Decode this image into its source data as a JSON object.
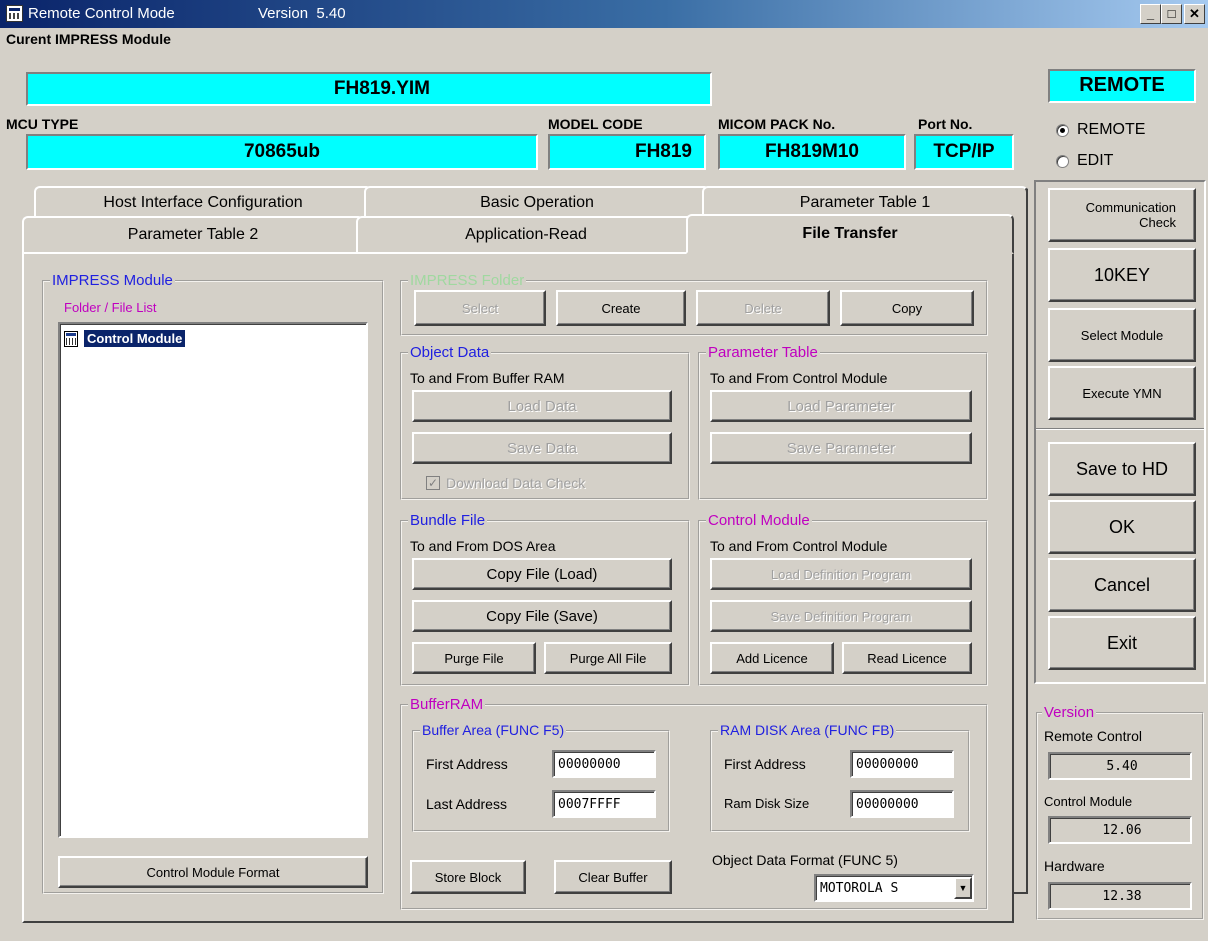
{
  "window": {
    "title": "Remote Control Mode",
    "version": "Version  5.40",
    "min_glyph": "_",
    "max_glyph": "□",
    "close_glyph": "✕"
  },
  "header": {
    "module_label": "Curent IMPRESS Module",
    "module_value": "FH819.YIM",
    "mcu_label": "MCU TYPE",
    "mcu_value": "70865ub",
    "model_label": "MODEL CODE",
    "model_value": "FH819",
    "micom_label": "MICOM PACK No.",
    "micom_value": "FH819M10",
    "port_label": "Port No.",
    "port_value": "TCP/IP"
  },
  "mode": {
    "status": "REMOTE",
    "options": [
      "REMOTE",
      "EDIT"
    ],
    "selected": "REMOTE"
  },
  "tabs": {
    "row1": [
      "Host Interface Configuration",
      "Basic Operation",
      "Parameter Table 1"
    ],
    "row2": [
      "Parameter Table 2",
      "Application-Read",
      "File Transfer"
    ],
    "active": "File Transfer"
  },
  "impress_module": {
    "title": "IMPRESS Module",
    "list_label": "Folder / File  List",
    "items": [
      "Control Module"
    ],
    "format_button": "Control Module Format"
  },
  "impress_folder": {
    "title": "IMPRESS Folder",
    "buttons": [
      "Select",
      "Create",
      "Delete",
      "Copy"
    ]
  },
  "object_data": {
    "title": "Object Data",
    "subtitle": "To and From Buffer RAM",
    "load": "Load Data",
    "save": "Save Data",
    "check_label": "Download Data Check",
    "check_glyph": "✓"
  },
  "parameter_table": {
    "title": "Parameter Table",
    "subtitle": "To and From Control Module",
    "load": "Load Parameter",
    "save": "Save Parameter"
  },
  "bundle_file": {
    "title": "Bundle File",
    "subtitle": "To and From DOS Area",
    "copy_load": "Copy File (Load)",
    "copy_save": "Copy File (Save)",
    "purge": "Purge File",
    "purge_all": "Purge All File"
  },
  "control_module": {
    "title": "Control Module",
    "subtitle": "To and From Control Module",
    "load_def": "Load Definition Program",
    "save_def": "Save Definition Program",
    "add_licence": "Add Licence",
    "read_licence": "Read Licence"
  },
  "buffer_ram": {
    "title": "BufferRAM",
    "buffer_area": {
      "title": "Buffer Area (FUNC F5)",
      "first_label": "First  Address",
      "first_value": "00000000",
      "last_label": "Last  Address",
      "last_value": "0007FFFF"
    },
    "ram_disk": {
      "title": "RAM DISK Area (FUNC FB)",
      "first_label": "First  Address",
      "first_value": "00000000",
      "size_label": "Ram Disk Size",
      "size_value": "00000000"
    },
    "store_block": "Store Block",
    "clear_buffer": "Clear Buffer",
    "format_label": "Object Data Format (FUNC 5)",
    "format_value": "MOTOROLA S",
    "dropdown_glyph": "▼"
  },
  "side": {
    "comm_check": "Communication\nCheck",
    "tenkey": "10KEY",
    "select_module": "Select Module",
    "execute_ymn": "Execute YMN",
    "save_hd": "Save to HD",
    "ok": "OK",
    "cancel": "Cancel",
    "exit": "Exit"
  },
  "version": {
    "title": "Version",
    "remote_label": "Remote Control",
    "remote_value": "5.40",
    "control_label": "Control Module",
    "control_value": "12.06",
    "hardware_label": "Hardware",
    "hardware_value": "12.38"
  },
  "colors": {
    "accent_field": "#00ffff",
    "title_bar": "#0a246a",
    "group_title_blue": "#2020e0",
    "group_title_magenta": "#c000c0",
    "disabled_green": "#a0d8a0",
    "window_face": "#d4d0c8"
  }
}
